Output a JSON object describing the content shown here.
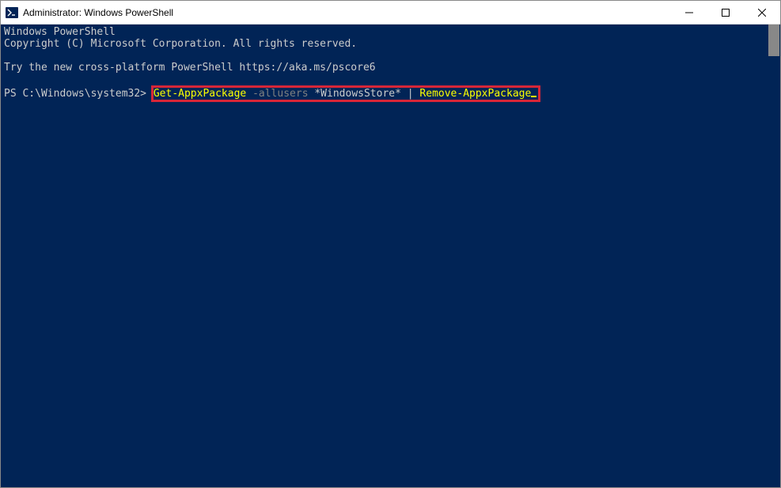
{
  "titlebar": {
    "title": "Administrator: Windows PowerShell"
  },
  "console": {
    "line1": "Windows PowerShell",
    "line2": "Copyright (C) Microsoft Corporation. All rights reserved.",
    "line3": "Try the new cross-platform PowerShell https://aka.ms/pscore6",
    "prompt": "PS C:\\Windows\\system32> ",
    "cmd_get": "Get-AppxPackage",
    "cmd_flag": " -allusers",
    "cmd_arg": " *WindowsStore*",
    "cmd_pipe": " |",
    "cmd_remove": " Remove-AppxPackage"
  },
  "colors": {
    "background": "#012456",
    "foreground": "#cccccc",
    "yellow": "#ffff00",
    "gray": "#808080",
    "highlight_border": "#d72638"
  }
}
